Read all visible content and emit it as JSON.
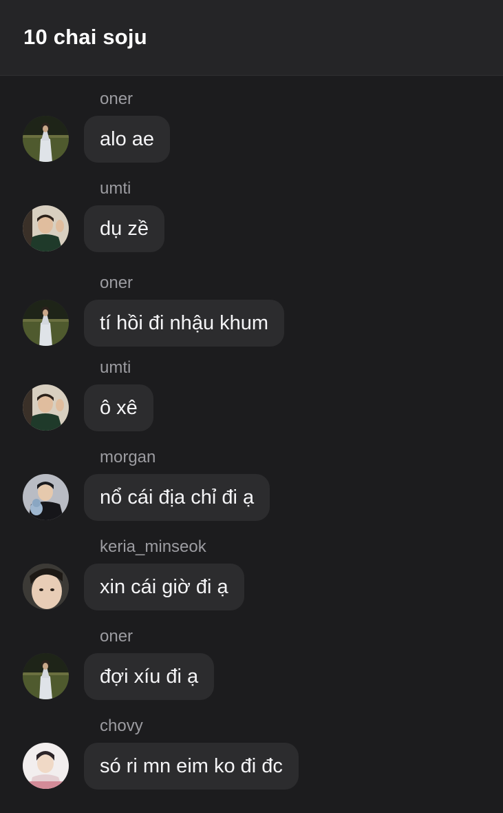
{
  "header": {
    "title": "10 chai soju"
  },
  "messages": [
    {
      "sender": "oner",
      "text": "alo ae",
      "avatar": "oner-avatar"
    },
    {
      "sender": "umti",
      "text": "dụ zề",
      "avatar": "umti-avatar"
    },
    {
      "sender": "oner",
      "text": "tí hồi đi nhậu khum",
      "avatar": "oner-avatar"
    },
    {
      "sender": "umti",
      "text": "ô xê",
      "avatar": "umti-avatar"
    },
    {
      "sender": "morgan",
      "text": "nổ cái địa chỉ đi ạ",
      "avatar": "morgan-avatar"
    },
    {
      "sender": "keria_minseok",
      "text": "xin cái giờ đi ạ",
      "avatar": "keria-avatar"
    },
    {
      "sender": "oner",
      "text": "đợi xíu đi ạ",
      "avatar": "oner-avatar"
    },
    {
      "sender": "chovy",
      "text": "só ri mn eim ko đi đc",
      "avatar": "chovy-avatar"
    }
  ]
}
